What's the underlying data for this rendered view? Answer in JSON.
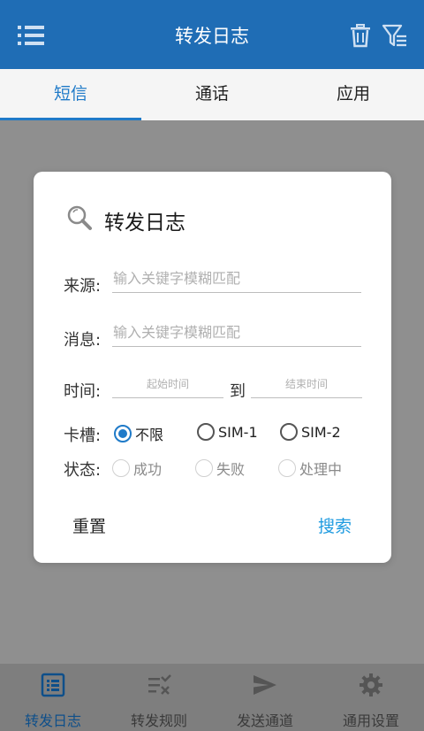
{
  "app": {
    "title": "转发日志"
  },
  "tabs": [
    {
      "label": "短信",
      "active": true
    },
    {
      "label": "通话",
      "active": false
    },
    {
      "label": "应用",
      "active": false
    }
  ],
  "dialog": {
    "title": "转发日志",
    "source": {
      "label": "来源:",
      "placeholder": "输入关键字模糊匹配"
    },
    "message": {
      "label": "消息:",
      "placeholder": "输入关键字模糊匹配"
    },
    "time": {
      "label": "时间:",
      "start_placeholder": "起始时间",
      "to": "到",
      "end_placeholder": "结束时间"
    },
    "sim": {
      "label": "卡槽:",
      "options": [
        "不限",
        "SIM-1",
        "SIM-2"
      ],
      "selected": "不限"
    },
    "status": {
      "label": "状态:",
      "options": [
        "成功",
        "失败",
        "处理中"
      ]
    },
    "reset_label": "重置",
    "search_label": "搜索"
  },
  "bottom_nav": [
    {
      "label": "转发日志",
      "icon": "list-icon",
      "active": true
    },
    {
      "label": "转发规则",
      "icon": "rules-icon",
      "active": false
    },
    {
      "label": "发送通道",
      "icon": "send-icon",
      "active": false
    },
    {
      "label": "通用设置",
      "icon": "gear-icon",
      "active": false
    }
  ],
  "colors": {
    "primary": "#1f6db5",
    "accent": "#1f7ac8",
    "search_button": "#1f9be0"
  }
}
